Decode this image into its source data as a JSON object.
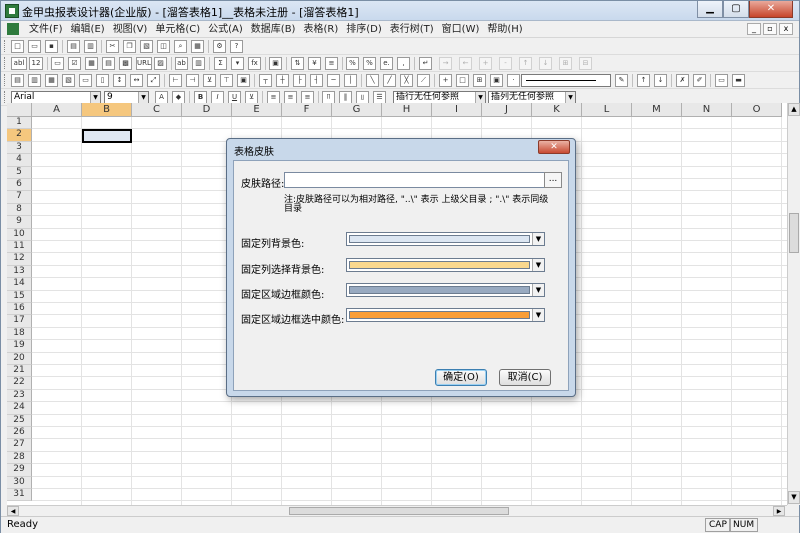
{
  "window": {
    "title": "金甲虫报表设计器(企业版) - [溜答表格1]__表格未注册 - [溜答表格1]",
    "min_label": "▁",
    "max_label": "▢",
    "close_label": "✕"
  },
  "menu": {
    "items": [
      "文件(F)",
      "编辑(E)",
      "视图(V)",
      "单元格(C)",
      "公式(A)",
      "数据库(B)",
      "表格(R)",
      "排序(D)",
      "表行树(T)",
      "窗口(W)",
      "帮助(H)"
    ]
  },
  "toolbar_format": {
    "font_name": "Arial",
    "font_size": "9",
    "bold": "B",
    "italic": "I",
    "underline": "U",
    "insert_row_mode": "插行无任何参照",
    "insert_col_mode": "插列无任何参照"
  },
  "toolbar_text": {
    "abl": "abl",
    "num": "12",
    "url": "URL",
    "sigma": "Σ",
    "fx": "fx",
    "percent": "%",
    "comma": ","
  },
  "sheet": {
    "columns": [
      "A",
      "B",
      "C",
      "D",
      "E",
      "F",
      "G",
      "H",
      "I",
      "J",
      "K",
      "L",
      "M",
      "N",
      "O"
    ],
    "rows": [
      "1",
      "2",
      "3",
      "4",
      "5",
      "6",
      "7",
      "8",
      "9",
      "10",
      "11",
      "12",
      "13",
      "14",
      "15",
      "16",
      "17",
      "18",
      "19",
      "20",
      "21",
      "22",
      "23",
      "24",
      "25",
      "26",
      "27",
      "28",
      "29",
      "30",
      "31"
    ],
    "active_col": "B",
    "active_row": "2"
  },
  "status": {
    "text": "Ready",
    "caps": "CAP",
    "num": "NUM"
  },
  "dialog": {
    "title": "表格皮肤",
    "close_label": "✕",
    "path_label": "皮肤路径:",
    "path_value": "",
    "browse_label": "...",
    "note": "注:皮肤路径可以为相对路径,  \"..\\\" 表示 上级父目录 ;  \".\\\" 表示同级目录",
    "fields": [
      {
        "label": "固定列背景色:",
        "color": "#dce6f2"
      },
      {
        "label": "固定列选择背景色:",
        "color": "#fad88e"
      },
      {
        "label": "固定区域边框颜色:",
        "color": "#98aac1"
      },
      {
        "label": "固定区域边框选中颜色:",
        "color": "#fa9e37"
      }
    ],
    "ok_label": "确定(O)",
    "cancel_label": "取消(C)"
  }
}
